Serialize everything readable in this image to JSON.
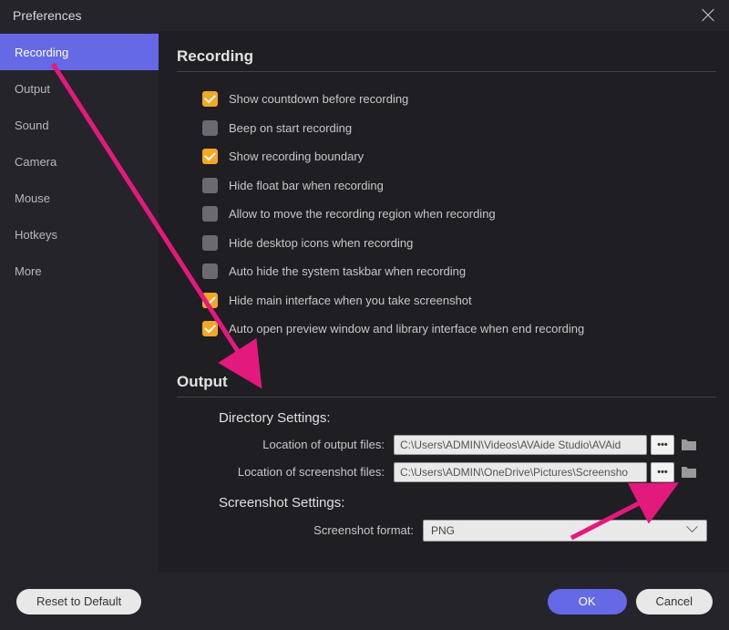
{
  "window": {
    "title": "Preferences"
  },
  "sidebar": {
    "items": [
      {
        "label": "Recording",
        "active": true
      },
      {
        "label": "Output",
        "active": false
      },
      {
        "label": "Sound",
        "active": false
      },
      {
        "label": "Camera",
        "active": false
      },
      {
        "label": "Mouse",
        "active": false
      },
      {
        "label": "Hotkeys",
        "active": false
      },
      {
        "label": "More",
        "active": false
      }
    ]
  },
  "sections": {
    "recording": {
      "title": "Recording",
      "options": [
        {
          "label": "Show countdown before recording",
          "checked": true
        },
        {
          "label": "Beep on start recording",
          "checked": false
        },
        {
          "label": "Show recording boundary",
          "checked": true
        },
        {
          "label": "Hide float bar when recording",
          "checked": false
        },
        {
          "label": "Allow to move the recording region when recording",
          "checked": false
        },
        {
          "label": "Hide desktop icons when recording",
          "checked": false
        },
        {
          "label": "Auto hide the system taskbar when recording",
          "checked": false
        },
        {
          "label": "Hide main interface when you take screenshot",
          "checked": true
        },
        {
          "label": "Auto open preview window and library interface when end recording",
          "checked": true
        }
      ]
    },
    "output": {
      "title": "Output",
      "directory": {
        "title": "Directory Settings:",
        "output_label": "Location of output files:",
        "output_value": "C:\\Users\\ADMIN\\Videos\\AVAide Studio\\AVAid",
        "screenshot_label": "Location of screenshot files:",
        "screenshot_value": "C:\\Users\\ADMIN\\OneDrive\\Pictures\\Screensho"
      },
      "screenshot": {
        "title": "Screenshot Settings:",
        "format_label": "Screenshot format:",
        "format_value": "PNG"
      }
    }
  },
  "footer": {
    "reset": "Reset to Default",
    "ok": "OK",
    "cancel": "Cancel"
  },
  "colors": {
    "accent": "#6569e6",
    "checkbox_active": "#f5a623",
    "annotation": "#e4197d"
  }
}
